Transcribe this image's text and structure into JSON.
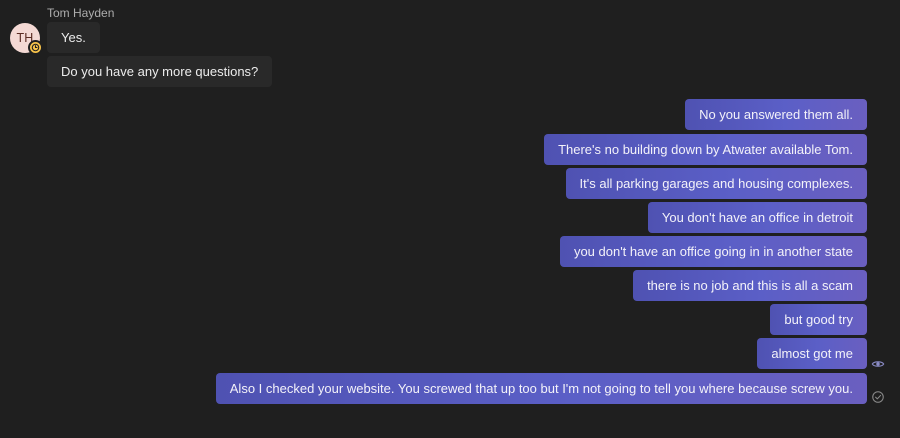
{
  "conversation": {
    "sender_name": "Tom Hayden",
    "avatar_initials": "TH",
    "avatar_status_icon": "clock-icon",
    "colors": {
      "background": "#1f1f1f",
      "incoming_bubble": "#292929",
      "outgoing_bubble": "#5b5fc7",
      "status_away": "#f8c34a"
    },
    "incoming": [
      "Yes.",
      "Do you have any more questions?"
    ],
    "outgoing": [
      "No you answered them all.",
      "There's no building down by Atwater available Tom.",
      "It's all parking garages and housing complexes.",
      "You don't have an office in detroit",
      "you don't have an office going in in another state",
      "there is no job and this is all a scam",
      "but good try",
      "almost got me",
      "Also I checked your website. You screwed that up too but I'm not going to tell you where because screw you."
    ],
    "receipt_icons": [
      "seen-eye-icon",
      "sent-check-icon"
    ]
  }
}
